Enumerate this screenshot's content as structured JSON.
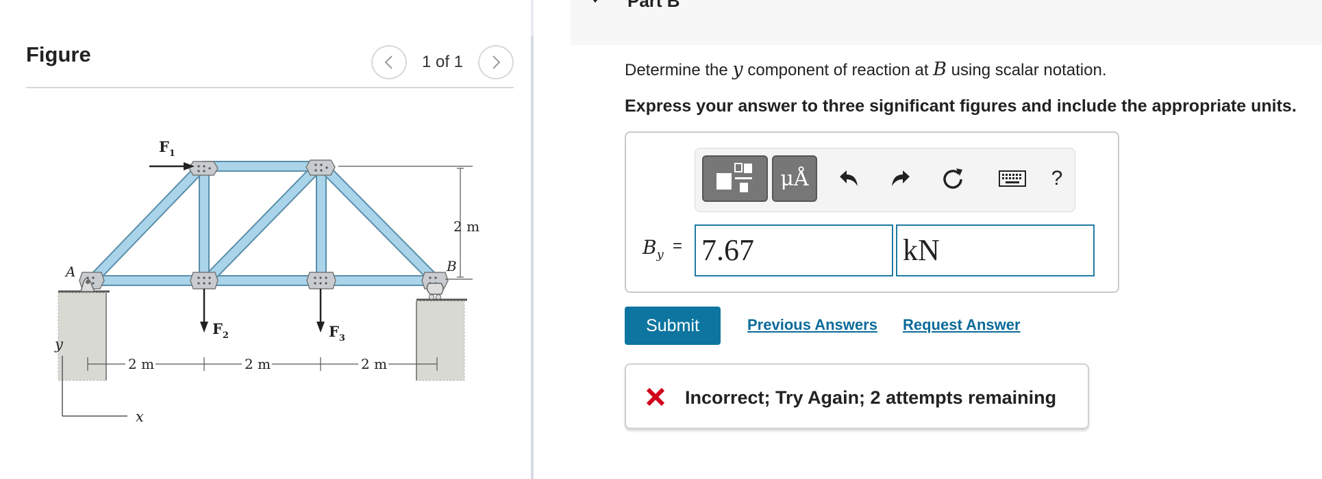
{
  "figure": {
    "title": "Figure",
    "pager_text": "1 of 1",
    "truss": {
      "point_a": "A",
      "point_b": "B",
      "force_1_symbol": "F",
      "force_1_sub": "1",
      "force_2_symbol": "F",
      "force_2_sub": "2",
      "force_3_symbol": "F",
      "force_3_sub": "3",
      "height_dim": "2 m",
      "span_1": "2 m",
      "span_2": "2 m",
      "span_3": "2 m",
      "axis_y": "y",
      "axis_x": "x"
    }
  },
  "part": {
    "title": "Part B"
  },
  "question": {
    "text_before": "Determine the ",
    "var_y": "y",
    "text_middle": " component of reaction at ",
    "var_b": "B",
    "text_after": " using scalar notation.",
    "instructions": "Express your answer to three significant figures and include the appropriate units."
  },
  "answer": {
    "toolbar": {
      "units_label": "μÅ",
      "help_label": "?"
    },
    "variable_main": "B",
    "variable_sub": "y",
    "equals": "=",
    "value": "7.67",
    "unit": "kN"
  },
  "actions": {
    "submit_label": "Submit",
    "previous_answers_label": "Previous Answers",
    "request_answer_label": "Request Answer"
  },
  "feedback": {
    "message": "Incorrect; Try Again; 2 attempts remaining",
    "status_color": "#d0021b"
  },
  "colors": {
    "accent": "#0d75a0",
    "link": "#0b6a9a",
    "member_fill": "#a9d4ea"
  }
}
